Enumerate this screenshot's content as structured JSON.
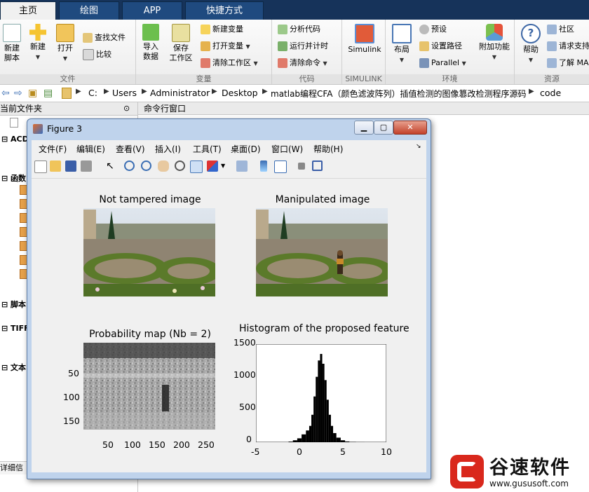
{
  "tabs": [
    {
      "label": "主页"
    },
    {
      "label": "绘图"
    },
    {
      "label": "APP"
    },
    {
      "label": "快捷方式"
    }
  ],
  "ribbon": {
    "file": {
      "label": "文件",
      "new_script": "新建\n脚本",
      "new": "新建",
      "open": "打开",
      "find_files": "查找文件",
      "compare": "比较"
    },
    "variable": {
      "label": "变量",
      "import": "导入\n数据",
      "save": "保存\n工作区",
      "new_var": "新建变量",
      "open_var": "打开变量",
      "clear_ws": "清除工作区"
    },
    "code": {
      "label": "代码",
      "analyze": "分析代码",
      "run_time": "运行并计时",
      "clear_cmd": "清除命令"
    },
    "simulink": {
      "label": "SIMULINK",
      "button": "Simulink"
    },
    "env": {
      "label": "环境",
      "layout": "布局",
      "prefs": "预设",
      "set_path": "设置路径",
      "parallel": "Parallel",
      "addons": "附加功能"
    },
    "resources": {
      "label": "资源",
      "help": "帮助",
      "community": "社区",
      "request": "请求支持",
      "learn": "了解 MA"
    }
  },
  "address": {
    "crumbs": [
      "C:",
      "Users",
      "Administrator",
      "Desktop",
      "matlab编程CFA（颜色滤波阵列）插值检测的图像篡改检测程序源码",
      "code"
    ]
  },
  "left_panel": {
    "title": "当前文件夹",
    "items": [
      "ACD",
      "函数",
      "脚本",
      "TIFF",
      "文本"
    ],
    "footer": "详细信"
  },
  "command_window": {
    "title": "命令行窗口"
  },
  "figure": {
    "title": "Figure 3",
    "menu": [
      "文件(F)",
      "编辑(E)",
      "查看(V)",
      "插入(I)",
      "工具(T)",
      "桌面(D)",
      "窗口(W)",
      "帮助(H)"
    ],
    "plots": {
      "not_tampered": {
        "title": "Not tampered image"
      },
      "manipulated": {
        "title": "Manipulated image"
      },
      "prob_map": {
        "title": "Probability map (Nb = 2)",
        "yticks": [
          "50",
          "100",
          "150"
        ],
        "xticks": [
          "50",
          "100",
          "150",
          "200",
          "250"
        ]
      },
      "histogram": {
        "title": "Histogram of the proposed feature",
        "yticks": [
          "1500",
          "1000",
          "500",
          "0"
        ],
        "xticks": [
          "-5",
          "0",
          "5",
          "10"
        ]
      }
    }
  },
  "chart_data": {
    "type": "bar",
    "title": "Histogram of the proposed feature",
    "xlabel": "",
    "ylabel": "",
    "xlim": [
      -5,
      10
    ],
    "ylim": [
      0,
      1500
    ],
    "x": [
      -1.0,
      -0.5,
      0.0,
      0.5,
      1.0,
      1.25,
      1.5,
      1.75,
      2.0,
      2.25,
      2.5,
      2.75,
      3.0,
      3.25,
      3.5,
      3.75,
      4.0,
      4.5,
      5.0,
      5.5,
      6.0,
      7.0
    ],
    "values": [
      10,
      30,
      60,
      120,
      180,
      250,
      420,
      700,
      1000,
      1250,
      1350,
      1200,
      950,
      650,
      420,
      250,
      140,
      70,
      30,
      12,
      6,
      2
    ]
  },
  "watermark": {
    "brand": "谷速软件",
    "url": "www.gususoft.com"
  },
  "colors": {
    "tabbar": "#16335a",
    "accent": "#1f4a7f",
    "watermark_red": "#d9281c"
  }
}
